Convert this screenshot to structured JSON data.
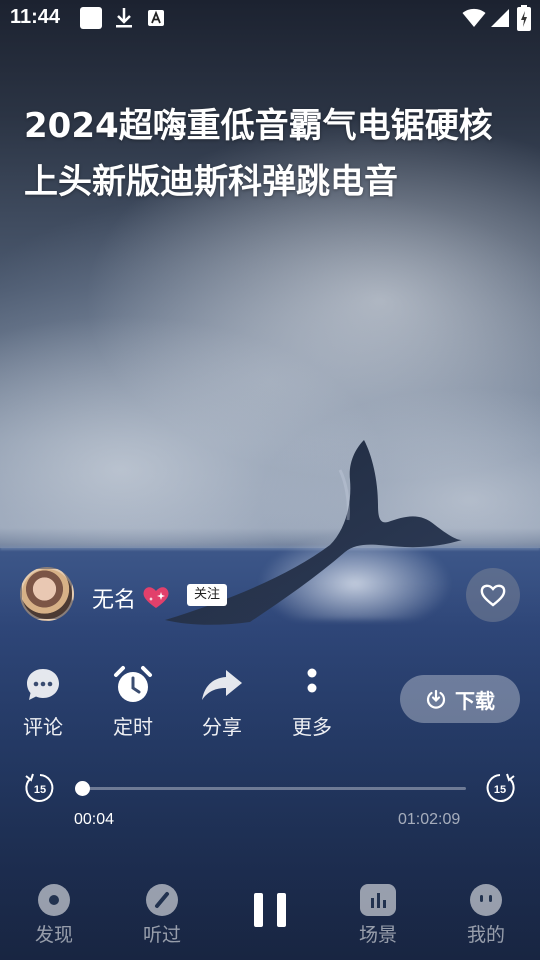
{
  "status_bar": {
    "time": "11:44",
    "icons": [
      "notification-square-icon",
      "download-icon",
      "a-icon",
      "wifi-icon",
      "signal-icon",
      "battery-icon"
    ]
  },
  "title": "2024超嗨重低音霸气电锯硬核上头新版迪斯科弹跳电音",
  "author": {
    "name": "无名",
    "follow_label": "关注"
  },
  "actions": [
    {
      "label": "评论",
      "icon": "comment-icon"
    },
    {
      "label": "定时",
      "icon": "alarm-clock-icon"
    },
    {
      "label": "分享",
      "icon": "share-icon"
    },
    {
      "label": "更多",
      "icon": "more-icon"
    }
  ],
  "download_label": "下载",
  "player": {
    "skip_back": "15",
    "skip_forward": "15",
    "current_time": "00:04",
    "total_time": "01:02:09",
    "progress": 0.001
  },
  "nav": [
    {
      "label": "发现",
      "icon": "discover-icon"
    },
    {
      "label": "听过",
      "icon": "history-icon"
    },
    {
      "label": "场景",
      "icon": "scene-icon"
    },
    {
      "label": "我的",
      "icon": "profile-icon"
    }
  ],
  "colors": {
    "sea": "#2f477a",
    "sky": "#7d8ca2",
    "accent": "#ffffff"
  }
}
